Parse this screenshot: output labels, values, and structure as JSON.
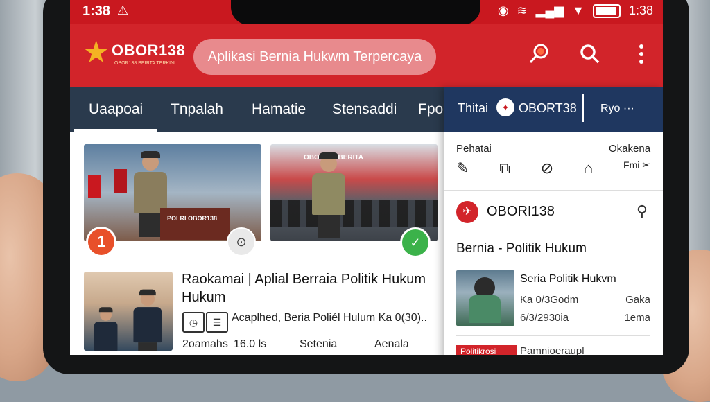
{
  "status_bar": {
    "time": "1:38",
    "right_time": "1:38"
  },
  "header": {
    "logo_text": "OBOR138",
    "logo_subtitle": "OBOR138 BERITA TERKINI",
    "search_placeholder": "Aplikasi Bernia Hukwm Terpercaya"
  },
  "tabs": [
    {
      "label": "Uaapoai"
    },
    {
      "label": "Tnpalah"
    },
    {
      "label": "Hamatie"
    },
    {
      "label": "Stensaddi"
    },
    {
      "label": "Fpo"
    }
  ],
  "panel": {
    "top_left": "Thitai",
    "top_brand": "OBORT38",
    "top_more": "Ryo ···",
    "label_left": "Pehatai",
    "label_right": "Okakena",
    "icon_caption": "Fmi",
    "brand_name": "OBORI138",
    "section_title": "Bernia - Politik Hukum",
    "article_title": "Seria Politik Hukvm",
    "meta_1_left": "Ka 0/3Godm",
    "meta_1_right": "Gaka",
    "meta_2_left": "6/3/2930ia",
    "meta_2_right": "1ema",
    "red_tag": "Politikrosi",
    "red_tag_text": "Pamnioeraupl"
  },
  "feed": {
    "card1_badge": "1",
    "card1_podium": "POLRI OBOR138",
    "card2_banner": "OBOR138 BERITA",
    "article_title": "Raokamai | Aplial Berraia Politik Hukum Hukum",
    "article_meta": "Acaplhed, Beria Poliél Hulum Ka 0(30)..",
    "bottom_1": "2oamahs",
    "bottom_2": "16.0 ls",
    "bottom_3": "Setenia",
    "bottom_4": "Aenala"
  },
  "colors": {
    "brand_red": "#d2242a",
    "tab_bar": "#2a3a4d",
    "panel_header": "#1f3760",
    "gold": "#f4b223"
  }
}
